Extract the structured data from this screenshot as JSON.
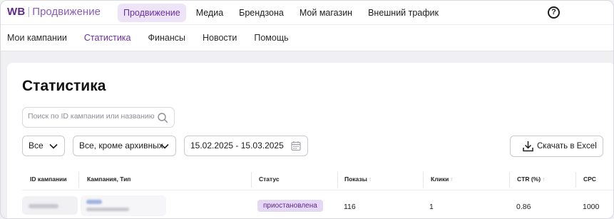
{
  "app": {
    "logo_brand": "WB",
    "logo_sep": "|",
    "logo_product": "Продвижение"
  },
  "top_nav": [
    {
      "label": "Продвижение",
      "active": true
    },
    {
      "label": "Медиа",
      "active": false
    },
    {
      "label": "Брендзона",
      "active": false
    },
    {
      "label": "Мой магазин",
      "active": false
    },
    {
      "label": "Внешний трафик",
      "active": false
    }
  ],
  "help_glyph": "?",
  "sub_nav": [
    {
      "label": "Мои кампании",
      "active": false
    },
    {
      "label": "Статистика",
      "active": true
    },
    {
      "label": "Финансы",
      "active": false
    },
    {
      "label": "Новости",
      "active": false
    },
    {
      "label": "Помощь",
      "active": false
    }
  ],
  "page": {
    "title": "Статистика"
  },
  "search": {
    "placeholder": "Поиск по ID кампании или названию",
    "value": ""
  },
  "filters": {
    "type_select": "Все",
    "status_select": "Все, кроме архивных",
    "date_range": "15.02.2025 - 15.03.2025"
  },
  "export_button": "Скачать в Excel",
  "table": {
    "columns": [
      "ID кампании",
      "Кампания, Тип",
      "Статус",
      "Показы",
      "Клики",
      "CTR (%)",
      "CPC"
    ],
    "sortable_arrow": "↑",
    "rows": [
      {
        "status": "приостановлена",
        "impressions": "116",
        "clicks": "1",
        "ctr": "0.86",
        "cpc": "1000"
      }
    ]
  },
  "colors": {
    "accent": "#6a2fa3",
    "accent_bg": "#ede4f7",
    "badge_bg": "#e5d8f4",
    "page_bg": "#f0f0f3"
  },
  "icons": [
    "question-circle-icon",
    "search-icon",
    "chevron-down-icon",
    "calendar-icon",
    "download-icon"
  ]
}
